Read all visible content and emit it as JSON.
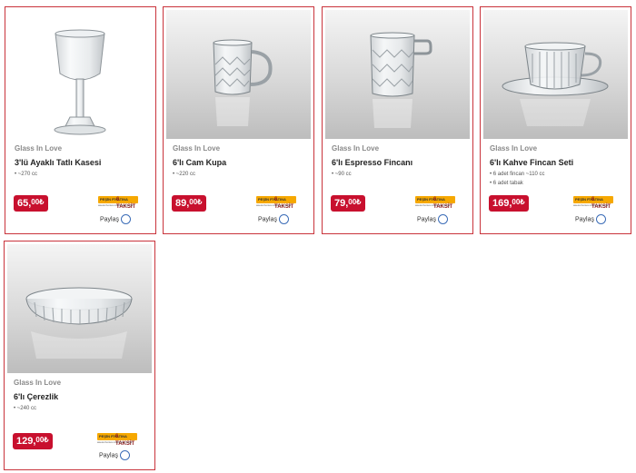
{
  "products": [
    {
      "brand": "Glass In Love",
      "name": "3'lü Ayaklı Tatlı Kasesi",
      "specs": [
        "• ~270 cc"
      ],
      "price_main": "65,",
      "price_dec": "00₺",
      "promo_top_a": "PEŞİN FİYATINA",
      "promo_top_b": "6 TAKSİT",
      "promo_bottom": "axess bonus maximum paraf",
      "share_label": "Paylaş",
      "image": "stemmed-glass-image"
    },
    {
      "brand": "Glass In Love",
      "name": "6'lı Cam Kupa",
      "specs": [
        "• ~220 cc"
      ],
      "price_main": "89,",
      "price_dec": "00₺",
      "promo_top_a": "PEŞİN FİYATINA",
      "promo_top_b": "6 TAKSİT",
      "promo_bottom": "axess bonus maximum paraf",
      "share_label": "Paylaş",
      "image": "glass-mug-image"
    },
    {
      "brand": "Glass In Love",
      "name": "6'lı Espresso Fincanı",
      "specs": [
        "• ~90 cc"
      ],
      "price_main": "79,",
      "price_dec": "00₺",
      "promo_top_a": "PEŞİN FİYATINA",
      "promo_top_b": "6 TAKSİT",
      "promo_bottom": "axess bonus maximum paraf",
      "share_label": "Paylaş",
      "image": "espresso-cup-image"
    },
    {
      "brand": "Glass In Love",
      "name": "6'lı Kahve Fincan Seti",
      "specs": [
        "• 6 adet fincan ~110 cc",
        "• 6 adet tabak"
      ],
      "price_main": "169,",
      "price_dec": "00₺",
      "promo_top_a": "PEŞİN FİYATINA",
      "promo_top_b": "6 TAKSİT",
      "promo_bottom": "axess bonus maximum paraf",
      "share_label": "Paylaş",
      "image": "coffee-cup-saucer-image"
    },
    {
      "brand": "Glass In Love",
      "name": "6'lı Çerezlik",
      "specs": [
        "• ~240 cc"
      ],
      "price_main": "129,",
      "price_dec": "00₺",
      "promo_top_a": "PEŞİN FİYATINA",
      "promo_top_b": "6 TAKSİT",
      "promo_bottom": "axess bonus maximum paraf",
      "share_label": "Paylaş",
      "image": "glass-bowl-image"
    }
  ],
  "colors": {
    "accent": "#c8102e",
    "border": "#c9333b",
    "promo": "#f6a800",
    "share_circle": "#3b6cb7"
  }
}
